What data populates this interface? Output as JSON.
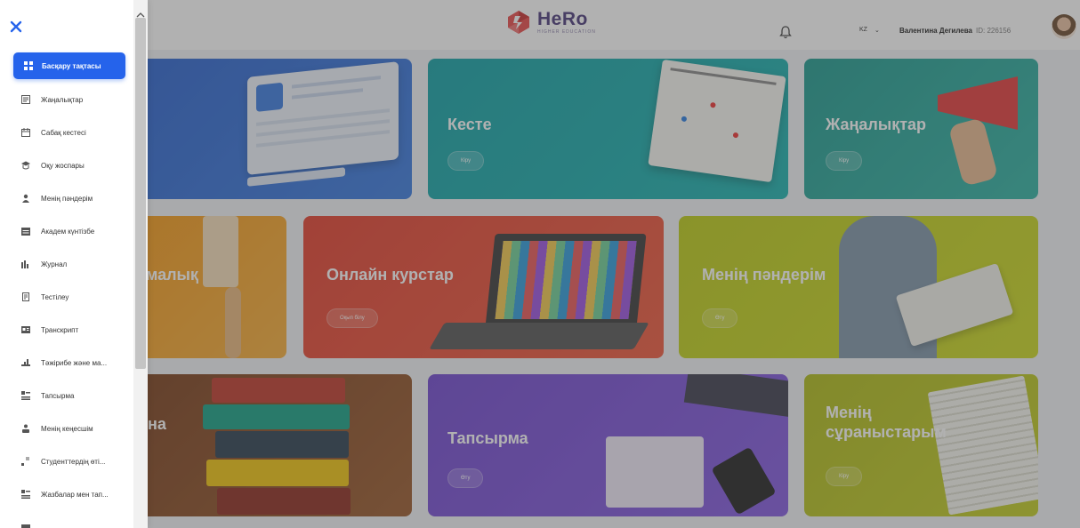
{
  "header": {
    "logo_title": "HeRo",
    "logo_subtitle": "HIGHER EDUCATION",
    "lang_label": "KZ",
    "user_name": "Валентина Дегилева",
    "user_id": "ID: 226156"
  },
  "cards": [
    {
      "title": "",
      "button": ""
    },
    {
      "title": "Кесте",
      "button": "Кіру"
    },
    {
      "title": "Жаңалықтар",
      "button": "Кіру"
    },
    {
      "title": "малық",
      "button": ""
    },
    {
      "title": "Онлайн курстар",
      "button": "Оқып білу"
    },
    {
      "title": "Менің пәндерім",
      "button": "Өту"
    },
    {
      "title": "на",
      "button": ""
    },
    {
      "title": "Тапсырма",
      "button": "Өту"
    },
    {
      "title": "Менің сұраныстарым",
      "button": "Кіру"
    }
  ],
  "sidebar": {
    "items": [
      {
        "label": "Басқару тақтасы",
        "icon": "dashboard-icon",
        "active": true
      },
      {
        "label": "Жаңалықтар",
        "icon": "news-icon"
      },
      {
        "label": "Сабақ кестесі",
        "icon": "schedule-icon"
      },
      {
        "label": "Оқу жоспары",
        "icon": "curriculum-icon"
      },
      {
        "label": "Менің пәндерім",
        "icon": "subjects-icon"
      },
      {
        "label": "Академ күнтізбе",
        "icon": "calendar-icon"
      },
      {
        "label": "Журнал",
        "icon": "journal-icon"
      },
      {
        "label": "Тестілеу",
        "icon": "test-icon"
      },
      {
        "label": "Транскрипт",
        "icon": "transcript-icon"
      },
      {
        "label": "Тәжірибе және ма...",
        "icon": "practice-icon"
      },
      {
        "label": "Тапсырма",
        "icon": "assignment-icon"
      },
      {
        "label": "Менің кеңесшім",
        "icon": "advisor-icon"
      },
      {
        "label": "Студенттердің өті...",
        "icon": "requests-icon"
      },
      {
        "label": "Жазбалар мен тап...",
        "icon": "notes-icon"
      }
    ]
  },
  "colors": {
    "accent": "#2563eb",
    "card_blue": "#2f6fd6",
    "card_teal": "#1aa3a8",
    "card_green": "#27a69a",
    "card_orange": "#f39a1e",
    "card_red": "#e8473b",
    "card_lime": "#c3d21a",
    "card_brown": "#8a4b22",
    "card_purple": "#7b4fd3",
    "card_olive": "#b6c21c"
  }
}
